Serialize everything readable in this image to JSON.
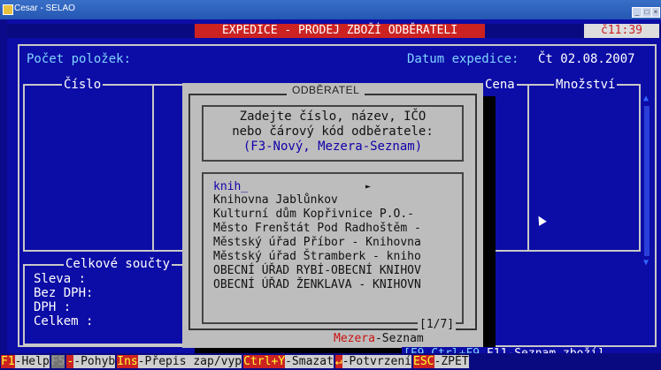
{
  "window": {
    "title": "Cesar - SELAO",
    "buttons": [
      "_",
      "□",
      "×"
    ]
  },
  "header": {
    "mode_title": "EXPEDICE - PRODEJ ZBOŽÍ ODBĚRATELI",
    "clock": "č11:39"
  },
  "main": {
    "item_count_label": "Počet položek:",
    "expedition_date_label": "Datum expedice:",
    "expedition_date_value": "Čt 02.08.2007",
    "columns": {
      "cislo": "Číslo",
      "cena": "Cena",
      "mnozstvi": "Množství"
    }
  },
  "totals": {
    "title": "Celkové součty",
    "rows": [
      "Sleva   :",
      "Bez DPH:",
      "DPH     :",
      "Celkem  :"
    ]
  },
  "dialog": {
    "title": "ODBĚRATEL",
    "prompt_lines": [
      "Zadejte číslo, název, IČO",
      "nebo čárový kód odběratele:",
      "(F3-Nový, Mezera-Seznam)"
    ],
    "query": "knih_",
    "results": [
      "Knihovna Jablůnkov",
      "Kulturní dům Kopřivnice P.O.-",
      "Město Frenštát Pod Radhoštěm -",
      "Městský úřad Příbor - Knihovna",
      "Městský úřad Štramberk - kniho",
      "OBECNÍ ÚŘAD RYBÍ-OBECNÍ KNIHOV",
      "OBECNÍ ÚŘAD ŽENKLAVA - KNIHOVN"
    ],
    "pager": "[1/7]",
    "mezera_key": "Mezera",
    "mezera_desc": "-Seznam"
  },
  "hint": {
    "keys": "[F9,Ctrl+F9,",
    "desc": "F11-Seznam zboží]"
  },
  "function_bar": [
    {
      "key": "F1",
      "desc": "-Help"
    },
    {
      "key": "F5",
      "desc": "",
      "dim": true
    },
    {
      "key": "-",
      "desc": "-Pohyb"
    },
    {
      "key": "Ins",
      "desc": "-Přepis zap/vyp"
    },
    {
      "key": "Ctrl+Y",
      "desc": "-Smazat"
    },
    {
      "key": "↵",
      "desc": "-Potvrzení"
    },
    {
      "key": "ESC",
      "desc": "-ZPĚT"
    }
  ],
  "colors": {
    "background": "#0c0ca6",
    "accent": "#cc2222",
    "dialog": "#bdbdbd"
  }
}
